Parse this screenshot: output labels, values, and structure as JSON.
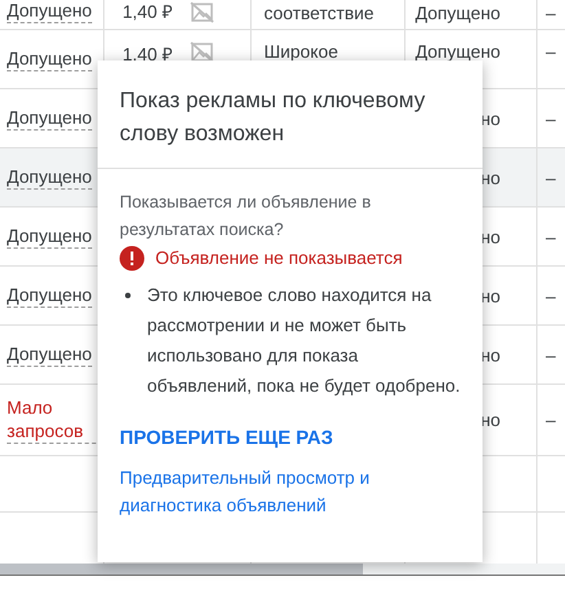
{
  "table": {
    "rows": [
      {
        "status": {
          "text": "Допущено",
          "kind": "approved"
        },
        "bid": "1,40 ₽",
        "match": "соответствие",
        "review": "Допущено",
        "column_5": "–",
        "selected": false
      },
      {
        "status": {
          "text": "Допущено",
          "kind": "approved"
        },
        "bid": "1,40 ₽",
        "match": "Широкое",
        "review": "Допущено",
        "column_5": "–",
        "selected": false
      },
      {
        "status": {
          "text": "Допущено",
          "kind": "approved"
        },
        "review": "но",
        "column_5": "–",
        "selected": false
      },
      {
        "status": {
          "text": "Допущено",
          "kind": "approved"
        },
        "review": "но",
        "column_5": "–",
        "selected": true
      },
      {
        "status": {
          "text": "Допущено",
          "kind": "approved"
        },
        "review": "но",
        "column_5": "–",
        "selected": false
      },
      {
        "status": {
          "text": "Допущено",
          "kind": "approved"
        },
        "review": "но",
        "column_5": "–",
        "selected": false
      },
      {
        "status": {
          "text": "Допущено",
          "kind": "approved"
        },
        "review": "но",
        "column_5": "–",
        "selected": false
      },
      {
        "status": {
          "text": "Мало запросов",
          "kind": "limited"
        },
        "review": "но",
        "column_5": "–",
        "selected": false
      }
    ]
  },
  "popup": {
    "title": "Показ рекламы по ключевому слову возможен",
    "question": "Показывается ли объявление в результатах поиска?",
    "result": {
      "text": "Объявление не показывается",
      "kind": "error"
    },
    "bullets": [
      "Это ключевое слово находится на рассмотрении и не может быть использовано для показа объявлений, пока не будет одобрено."
    ],
    "button": "ПРОВЕРИТЬ ЕЩЕ РАЗ",
    "link": "Предварительный просмотр и диагностика объявлений"
  }
}
